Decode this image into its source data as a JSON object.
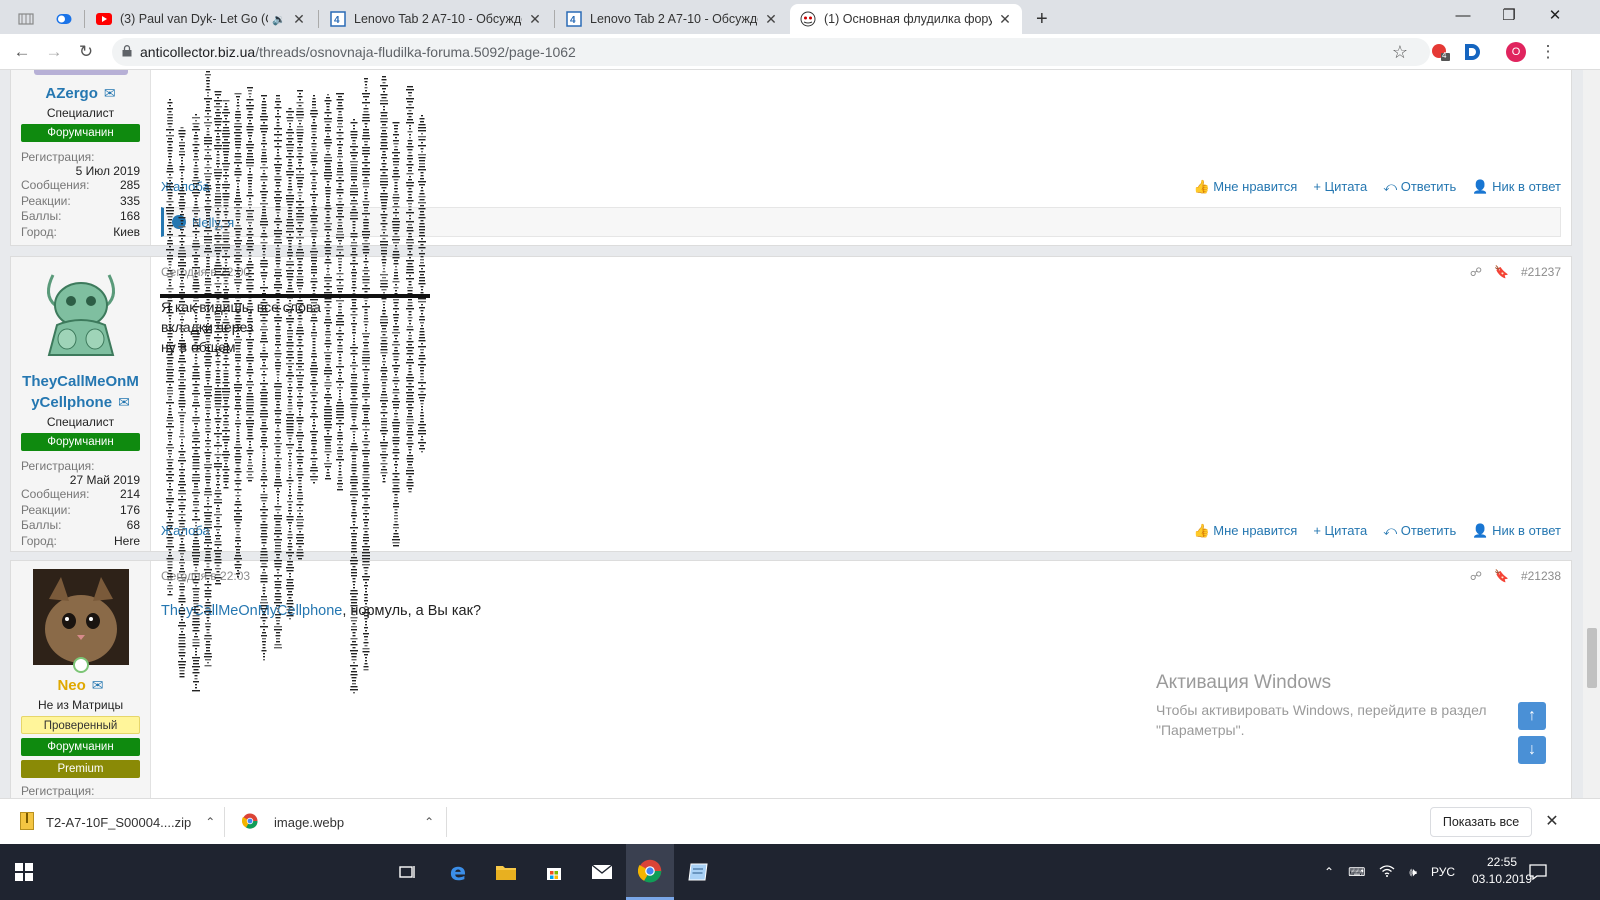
{
  "browser": {
    "tabs": [
      {
        "title": "(3) Paul van Dyk- Let Go (Ori",
        "icon": "youtube-icon",
        "muted_icon": "speaker-icon"
      },
      {
        "title": "Lenovo Tab 2 A7-10 - Обсужден",
        "icon": "4pda-icon"
      },
      {
        "title": "Lenovo Tab 2 A7-10 - Обсужден",
        "icon": "4pda-icon"
      },
      {
        "title": "(1) Основная флудилка форума",
        "icon": "forum-icon",
        "active": true
      }
    ],
    "new_tab": "+",
    "url_host": "anticollector.biz.ua",
    "url_path": "/threads/osnovnaja-fludilka-foruma.5092/page-1062",
    "ext_badge_count": "4",
    "profile_initial": "O"
  },
  "posts": [
    {
      "user": {
        "name": "AZergo",
        "title": "Специалист",
        "badges": [
          "Форумчанин"
        ]
      },
      "stats": {
        "registration_label": "Регистрация:",
        "registration_value": "5 Июл 2019",
        "rows": [
          {
            "k": "Сообщения:",
            "v": "285"
          },
          {
            "k": "Реакции:",
            "v": "335"
          },
          {
            "k": "Баллы:",
            "v": "168"
          },
          {
            "k": "Город:",
            "v": "Киев"
          }
        ]
      },
      "complaint": "Жалоба",
      "likes_text": "Nelly, я",
      "actions": {
        "like": "Мне нравится",
        "quote": "Цитата",
        "reply": "Ответить",
        "nick": "Ник в ответ"
      }
    },
    {
      "meta": "Сегодня в 22:00",
      "number": "#21237",
      "user": {
        "name": "TheyCallMeOnMyCellphone",
        "name_line1": "TheyCallMeOnM",
        "name_line2": "yCellphone",
        "title": "Специалист",
        "badges": [
          "Форумчанин"
        ]
      },
      "stats": {
        "registration_label": "Регистрация:",
        "registration_value": "27 Май 2019",
        "rows": [
          {
            "k": "Сообщения:",
            "v": "214"
          },
          {
            "k": "Реакции:",
            "v": "176"
          },
          {
            "k": "Баллы:",
            "v": "68"
          },
          {
            "k": "Город:",
            "v": "Here"
          }
        ]
      },
      "message_lines": [
        "Я как видишь, все слова",
        "вкладки через",
        "ну в общем"
      ],
      "complaint": "Жалоба",
      "actions": {
        "like": "Мне нравится",
        "quote": "Цитата",
        "reply": "Ответить",
        "nick": "Ник в ответ"
      }
    },
    {
      "meta": "Сегодня в 22:03",
      "number": "#21238",
      "user": {
        "name": "Neo",
        "title": "Не из Матрицы",
        "badges": [
          "Проверенный",
          "Форумчанин",
          "Premium"
        ]
      },
      "stats": {
        "registration_label": "Регистрация:"
      },
      "message": {
        "mention": "TheyCallMeOnMyCellphone",
        "text": ", нормуль, а Вы как?"
      }
    }
  ],
  "watermark": {
    "line1": "Активация Windows",
    "line2": "Чтобы активировать Windows, перейдите в раздел",
    "line3": "\"Параметры\"."
  },
  "downloads": {
    "items": [
      {
        "name": "T2-A7-10F_S00004....zip",
        "icon": "zip-icon"
      },
      {
        "name": "image.webp",
        "icon": "chrome-icon"
      }
    ],
    "show_all": "Показать все"
  },
  "taskbar": {
    "time": "22:55",
    "date": "03.10.2019",
    "lang": "РУС"
  },
  "colors": {
    "link": "#2577b1",
    "green_badge": "#0f8a0f",
    "premium": "#8a8a06"
  }
}
